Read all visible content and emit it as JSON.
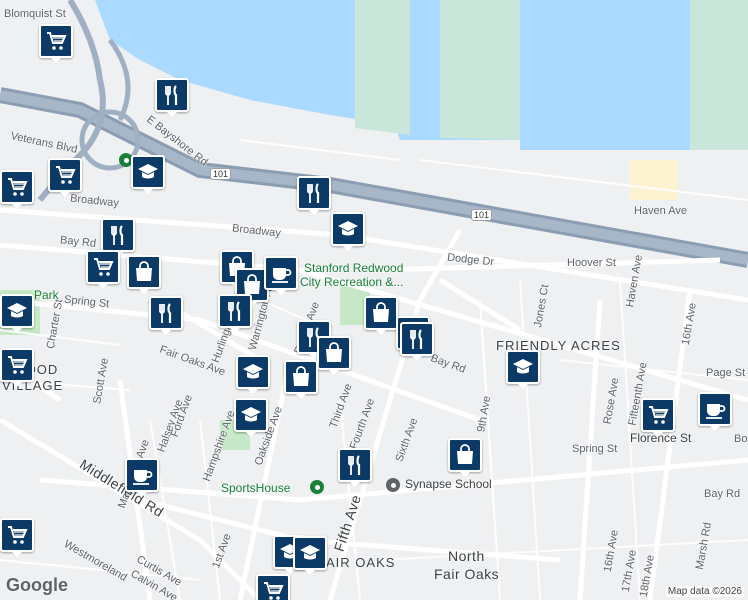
{
  "map": {
    "colors": {
      "water": "#aadaff",
      "land": "#eef0f2",
      "marsh": "#c8e6d9",
      "park": "#c6e8c6",
      "freeway": "#8a9db3",
      "road": "#ffffff",
      "pin": "#0b3a66"
    },
    "streets": [
      "Blomquist St",
      "Veterans Blvd",
      "E Bayshore Rd",
      "Broadway",
      "Broadway",
      "Bay Rd",
      "Bay Rd",
      "Bay Rd",
      "Spring St",
      "Spring St",
      "Charter St",
      "Scott Ave",
      "Fair Oaks Ave",
      "Hurlingame Ave",
      "Warrington Ave",
      "Barron Ave",
      "Third Ave",
      "Fourth Ave",
      "Fifth Ave",
      "Sixth Ave",
      "Dodge Dr",
      "Hoover St",
      "Haven Ave",
      "Haven Ave",
      "Jones Ct",
      "16th Ave",
      "Page St",
      "Rose Ave",
      "Fifteenth Ave",
      "Florence St",
      "9th Ave",
      "MacArthur Ave",
      "Halsey Ave",
      "Hampshire Ave",
      "Oakside Ave",
      "Middlefield Rd",
      "Westmoreland",
      "Curtis Ave",
      "Calvin Ave",
      "1st Ave",
      "16th Ave",
      "17th Ave",
      "18th Ave",
      "Marsh Rd",
      "Bay Rd",
      "Park",
      "Ford Ave",
      "Bo"
    ],
    "areas": [
      "FRIENDLY ACRES",
      "AIR OAKS",
      "North",
      "Fair Oaks",
      "DWOOD",
      "VILLAGE"
    ],
    "highway_shields": [
      "101",
      "101"
    ],
    "places": [
      "Stanford Redwood",
      "City Recreation &...",
      "SportsHouse",
      "Synapse School"
    ],
    "markers": [
      "shopping-cart-icon",
      "restaurant-icon",
      "school-icon",
      "shopping-cart-icon",
      "shopping-cart-icon",
      "restaurant-icon",
      "school-icon",
      "restaurant-icon",
      "shopping-cart-icon",
      "shopping-bag-icon",
      "restaurant-icon",
      "shopping-bag-icon",
      "shopping-bag-icon",
      "coffee-icon",
      "restaurant-icon",
      "school-icon",
      "shopping-cart-icon",
      "school-icon",
      "school-icon",
      "restaurant-icon",
      "shopping-bag-icon",
      "shopping-bag-icon",
      "shopping-bag-icon",
      "restaurant-icon",
      "restaurant-icon",
      "school-icon",
      "shopping-cart-icon",
      "coffee-icon",
      "shopping-bag-icon",
      "restaurant-icon",
      "coffee-icon",
      "shopping-cart-icon",
      "school-icon",
      "school-icon",
      "shopping-cart-icon"
    ],
    "logo": "Google",
    "attribution": "Map data ©2026"
  }
}
